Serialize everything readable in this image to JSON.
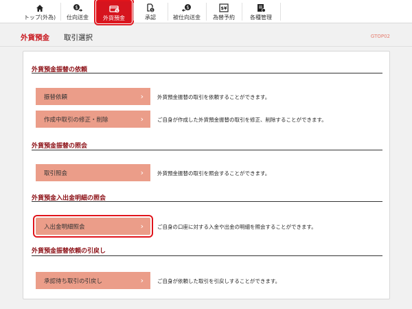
{
  "nav": {
    "items": [
      {
        "label": "トップ(外為)",
        "icon": "home-icon"
      },
      {
        "label": "仕向送金",
        "icon": "remit-out-icon"
      },
      {
        "label": "外貨預金",
        "icon": "foreign-deposit-icon",
        "active": true
      },
      {
        "label": "承認",
        "icon": "approval-icon"
      },
      {
        "label": "被仕向送金",
        "icon": "remit-in-icon"
      },
      {
        "label": "為替予約",
        "icon": "fx-contract-icon"
      },
      {
        "label": "各種管理",
        "icon": "management-icon"
      }
    ]
  },
  "header": {
    "title": "外貨預金",
    "subtitle": "取引選択",
    "screen_code": "GTOP02"
  },
  "sections": [
    {
      "title": "外貨預金振替の依頼",
      "actions": [
        {
          "label": "振替依頼",
          "description": "外貨預金振替の取引を依頼することができます。"
        },
        {
          "label": "作成中取引の修正・削除",
          "description": "ご自身が作成した外貨預金振替の取引を修正、削除することができます。"
        }
      ]
    },
    {
      "title": "外貨預金振替の照会",
      "actions": [
        {
          "label": "取引照会",
          "description": "外貨預金振替の取引を照会することができます。"
        }
      ]
    },
    {
      "title": "外貨預金入出金明細の照会",
      "actions": [
        {
          "label": "入出金明細照会",
          "description": "ご自身の口座に対する入金や出金の明細を照会することができます。",
          "highlighted": true
        }
      ]
    },
    {
      "title": "外貨預金振替依頼の引戻し",
      "actions": [
        {
          "label": "承認待ち取引の引戻し",
          "description": "ご自身が依頼した取引を引戻しすることができます。"
        }
      ]
    }
  ],
  "colors": {
    "brand_red": "#d6141e",
    "section_title": "#8b0e14",
    "button_fill": "#eb9d89",
    "code_text": "#e57b6d"
  }
}
